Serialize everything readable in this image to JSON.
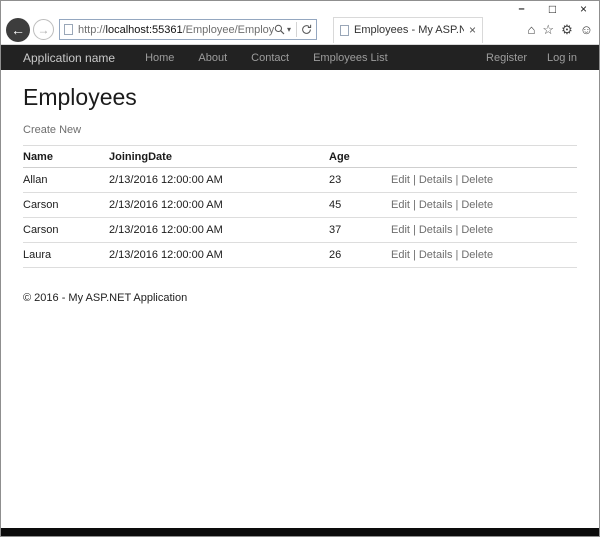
{
  "window": {
    "controls": {
      "minimize": "–",
      "maximize": "□",
      "close": "×"
    }
  },
  "browser": {
    "back_glyph": "←",
    "forward_glyph": "→",
    "url_scheme": "http://",
    "url_host": "localhost:55361",
    "url_path": "/Employee/Employees",
    "dropdown_caret": "▾",
    "tab": {
      "title": "Employees - My ASP.NET A...",
      "close": "×"
    },
    "toolbar": {
      "home": "⌂",
      "favorites": "☆",
      "settings": "⚙",
      "feedback": "☺"
    }
  },
  "navbar": {
    "brand": "Application name",
    "items": [
      {
        "label": "Home"
      },
      {
        "label": "About"
      },
      {
        "label": "Contact"
      },
      {
        "label": "Employees List"
      }
    ],
    "right_items": [
      {
        "label": "Register"
      },
      {
        "label": "Log in"
      }
    ]
  },
  "page": {
    "title": "Employees",
    "create_link": "Create New",
    "footer": "© 2016 - My ASP.NET Application"
  },
  "table": {
    "headers": {
      "name": "Name",
      "joining_date": "JoiningDate",
      "age": "Age"
    },
    "actions": {
      "edit": "Edit",
      "details": "Details",
      "delete": "Delete",
      "separator": "|"
    },
    "rows": [
      {
        "name": "Allan",
        "joining_date": "2/13/2016 12:00:00 AM",
        "age": "23"
      },
      {
        "name": "Carson",
        "joining_date": "2/13/2016 12:00:00 AM",
        "age": "45"
      },
      {
        "name": "Carson",
        "joining_date": "2/13/2016 12:00:00 AM",
        "age": "37"
      },
      {
        "name": "Laura",
        "joining_date": "2/13/2016 12:00:00 AM",
        "age": "26"
      }
    ]
  }
}
